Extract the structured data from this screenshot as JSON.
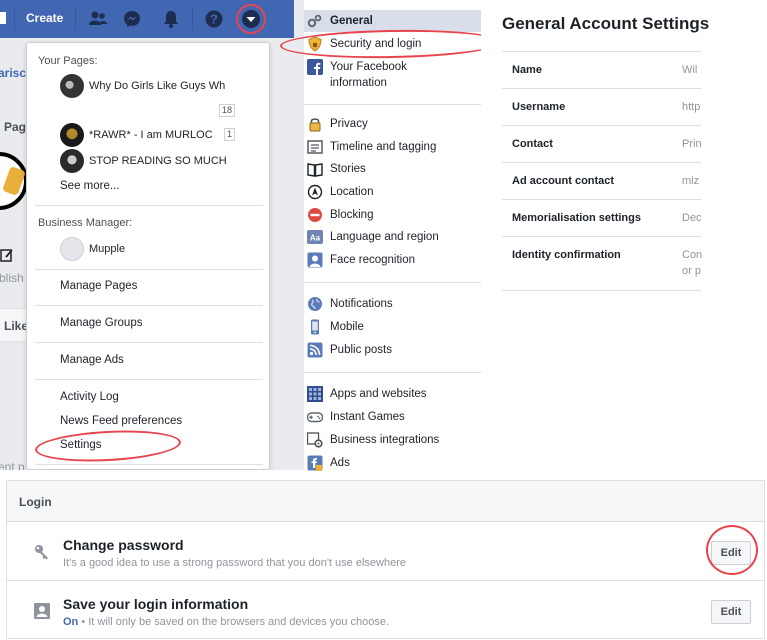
{
  "topbar": {
    "create_label": "Create",
    "icons": [
      "friends-icon",
      "messenger-icon",
      "notifications-icon",
      "help-icon",
      "account-menu-caret-icon"
    ]
  },
  "background_fragments": {
    "frag1": "arisc",
    "frag2": "Pag",
    "frag3": "blish",
    "frag4": "Like",
    "frag5": "ent p"
  },
  "dropdown": {
    "your_pages_header": "Your Pages:",
    "pages": [
      {
        "name": "Why Do Girls Like Guys Wh",
        "badge": "18"
      },
      {
        "name": "*RAWR* - I am MURLOC",
        "badge": "1"
      },
      {
        "name": "STOP READING SO MUCH",
        "badge": ""
      }
    ],
    "see_more": "See more...",
    "business_header": "Business Manager:",
    "business_name": "Mupple",
    "manage_pages": "Manage Pages",
    "manage_groups": "Manage Groups",
    "manage_ads": "Manage Ads",
    "activity_log": "Activity Log",
    "news_feed_prefs": "News Feed preferences",
    "settings": "Settings"
  },
  "settings_nav": {
    "items": [
      {
        "label": "General",
        "icon": "gears-icon"
      },
      {
        "label": "Security and login",
        "icon": "shield-icon"
      },
      {
        "label": "Your Facebook",
        "label2": "information",
        "icon": "facebook-icon"
      },
      {
        "label": "Privacy",
        "icon": "lock-icon"
      },
      {
        "label": "Timeline and tagging",
        "icon": "timeline-icon"
      },
      {
        "label": "Stories",
        "icon": "book-icon"
      },
      {
        "label": "Location",
        "icon": "location-icon"
      },
      {
        "label": "Blocking",
        "icon": "blocking-icon"
      },
      {
        "label": "Language and region",
        "icon": "language-icon"
      },
      {
        "label": "Face recognition",
        "icon": "face-icon"
      },
      {
        "label": "Notifications",
        "icon": "globe-icon"
      },
      {
        "label": "Mobile",
        "icon": "mobile-icon"
      },
      {
        "label": "Public posts",
        "icon": "rss-icon"
      },
      {
        "label": "Apps and websites",
        "icon": "apps-icon"
      },
      {
        "label": "Instant Games",
        "icon": "gamepad-icon"
      },
      {
        "label": "Business integrations",
        "icon": "business-gear-icon"
      },
      {
        "label": "Ads",
        "icon": "ads-icon"
      }
    ]
  },
  "general": {
    "title": "General Account Settings",
    "rows": [
      {
        "label": "Name",
        "value": "Wil"
      },
      {
        "label": "Username",
        "value": "http"
      },
      {
        "label": "Contact",
        "value": "Prin"
      },
      {
        "label": "Ad account contact",
        "value": "miz"
      },
      {
        "label": "Memorialisation settings",
        "value": "Dec"
      },
      {
        "label": "Identity confirmation",
        "value": "Con",
        "value2": "or p"
      }
    ]
  },
  "login": {
    "header": "Login",
    "rows": [
      {
        "title": "Change password",
        "desc": "It's a good idea to use a strong password that you don't use elsewhere",
        "button": "Edit",
        "icon": "key-icon"
      },
      {
        "title": "Save your login information",
        "desc_on": "On",
        "desc": " • It will only be saved on the browsers and devices you choose.",
        "button": "Edit",
        "icon": "id-card-icon"
      }
    ]
  },
  "colors": {
    "brand_blue": "#4267b2",
    "annotation_red": "#e8444c",
    "selected_nav": "#d8dfea"
  }
}
